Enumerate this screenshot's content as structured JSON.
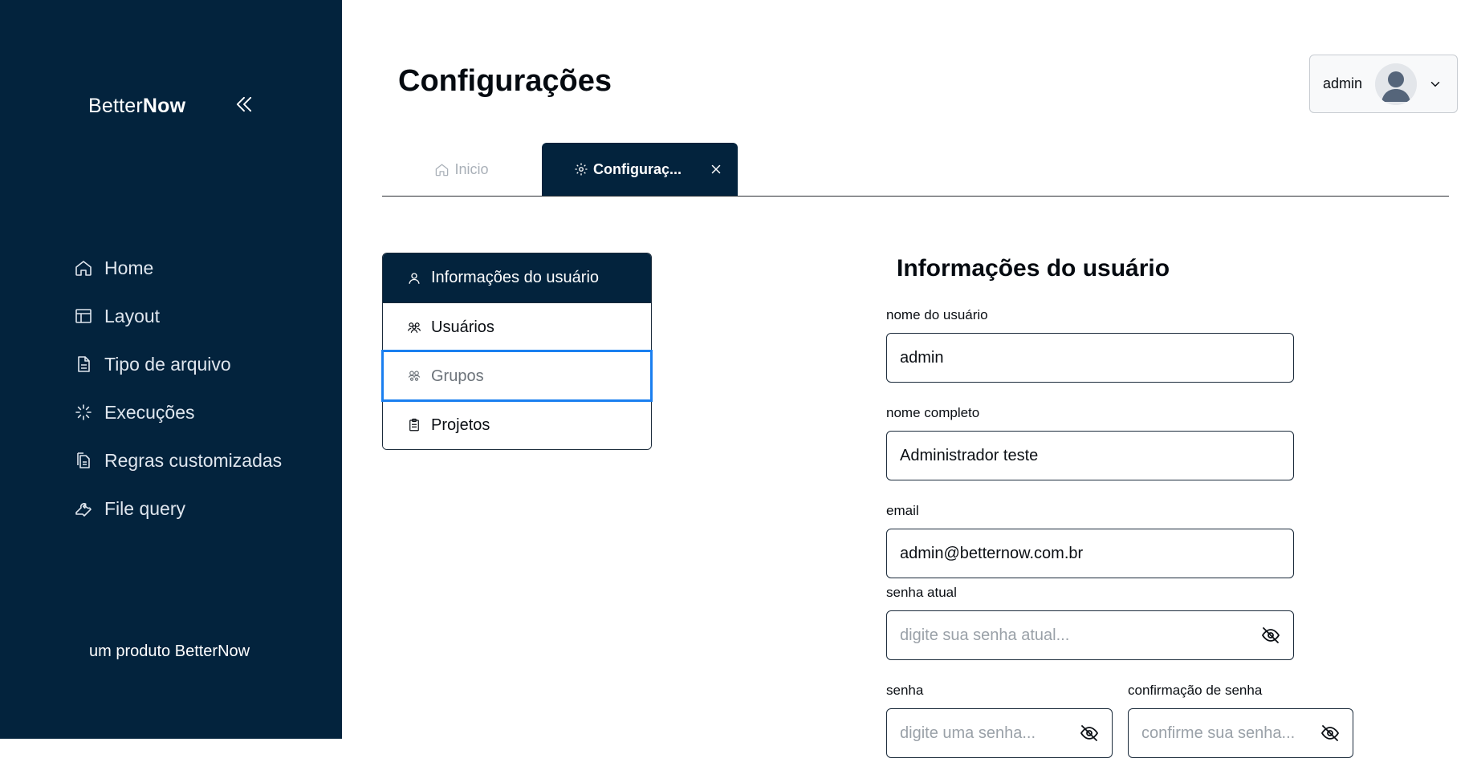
{
  "sidebar": {
    "brand_prefix": "Better",
    "brand_suffix": "Now",
    "items": [
      {
        "label": "Home",
        "icon": "home-icon"
      },
      {
        "label": "Layout",
        "icon": "layout-icon"
      },
      {
        "label": "Tipo de arquivo",
        "icon": "file-icon"
      },
      {
        "label": "Execuções",
        "icon": "loader-icon"
      },
      {
        "label": "Regras customizadas",
        "icon": "files-icon"
      },
      {
        "label": "File query",
        "icon": "wrench-icon"
      }
    ],
    "footer": "um produto BetterNow"
  },
  "header": {
    "title": "Configurações",
    "user": "admin"
  },
  "tabs": [
    {
      "label": "Inicio",
      "active": false
    },
    {
      "label": "Configuraç...",
      "active": true
    }
  ],
  "settings_menu": [
    {
      "label": "Informações do usuário",
      "icon": "user-icon"
    },
    {
      "label": "Usuários",
      "icon": "users-icon"
    },
    {
      "label": "Grupos",
      "icon": "groups-icon"
    },
    {
      "label": "Projetos",
      "icon": "clipboard-icon"
    }
  ],
  "form": {
    "title": "Informações do usuário",
    "username_label": "nome do usuário",
    "username_value": "admin",
    "fullname_label": "nome completo",
    "fullname_value": "Administrador teste",
    "email_label": "email",
    "email_value": "admin@betternow.com.br",
    "current_password_label": "senha atual",
    "current_password_placeholder": "digite sua senha atual...",
    "password_label": "senha",
    "password_placeholder": "digite uma senha...",
    "confirm_label": "confirmação de senha",
    "confirm_placeholder": "confirme sua senha..."
  },
  "colors": {
    "sidebar": "#03233d",
    "focus": "#1a7ff0"
  }
}
